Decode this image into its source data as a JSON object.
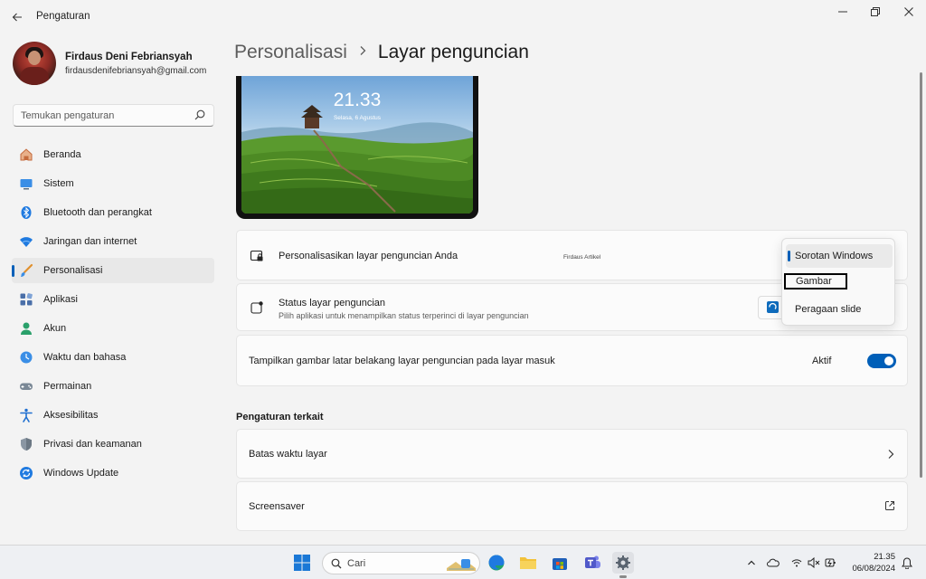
{
  "window": {
    "title": "Pengaturan"
  },
  "profile": {
    "name": "Firdaus Deni Febriansyah",
    "email": "firdausdenifebriansyah@gmail.com"
  },
  "search": {
    "placeholder": "Temukan pengaturan"
  },
  "sidebar": {
    "items": [
      {
        "label": "Beranda",
        "icon": "home-icon"
      },
      {
        "label": "Sistem",
        "icon": "system-icon"
      },
      {
        "label": "Bluetooth dan perangkat",
        "icon": "bluetooth-icon"
      },
      {
        "label": "Jaringan dan internet",
        "icon": "wifi-icon"
      },
      {
        "label": "Personalisasi",
        "icon": "brush-icon",
        "active": true
      },
      {
        "label": "Aplikasi",
        "icon": "apps-icon"
      },
      {
        "label": "Akun",
        "icon": "account-icon"
      },
      {
        "label": "Waktu dan bahasa",
        "icon": "globe-clock-icon"
      },
      {
        "label": "Permainan",
        "icon": "gamepad-icon"
      },
      {
        "label": "Aksesibilitas",
        "icon": "accessibility-icon"
      },
      {
        "label": "Privasi dan keamanan",
        "icon": "shield-icon"
      },
      {
        "label": "Windows Update",
        "icon": "update-icon"
      }
    ]
  },
  "breadcrumb": {
    "parent": "Personalisasi",
    "current": "Layar penguncian"
  },
  "preview": {
    "time": "21.33",
    "date": "Selasa, 6 Agustus"
  },
  "settings": {
    "personalize": {
      "title": "Personalisasikan layar penguncian Anda",
      "watermark": "Firdaus Artikel"
    },
    "status": {
      "title": "Status layar penguncian",
      "subtitle": "Pilih aplikasi untuk menampilkan status terperinci di layar penguncian"
    },
    "signin_background": {
      "title": "Tampilkan gambar latar belakang layar penguncian pada layar masuk",
      "toggle_label": "Aktif",
      "toggle_on": true
    }
  },
  "dropdown": {
    "options": [
      "Sorotan Windows",
      "Gambar",
      "Peragaan slide"
    ],
    "selected": "Sorotan Windows",
    "focused": "Gambar"
  },
  "related": {
    "title": "Pengaturan terkait",
    "items": [
      {
        "label": "Batas waktu layar",
        "action": "chevron-right-icon"
      },
      {
        "label": "Screensaver",
        "action": "open-external-icon"
      }
    ]
  },
  "taskbar": {
    "search_label": "Cari",
    "time": "21.35",
    "date": "06/08/2024"
  },
  "colors": {
    "accent": "#005fb8",
    "background": "#f3f3f3",
    "card": "#fbfbfb"
  }
}
